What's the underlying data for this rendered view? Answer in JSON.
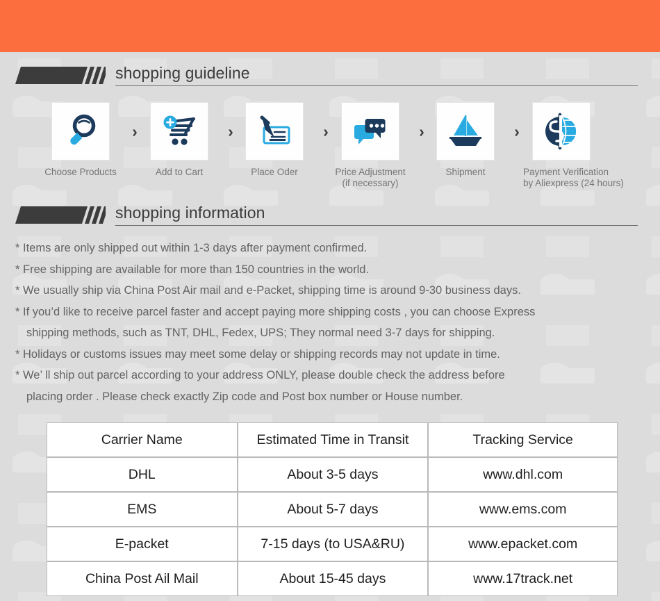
{
  "theme": {
    "accent_orange": "#fc6e3d",
    "page_background": "#dcdcdc",
    "banner_dark": "#3c3c3c",
    "icon_navy": "#1b3a5c",
    "icon_cyan": "#29abe2",
    "text_gray": "#636363",
    "table_border": "#b9b9b9"
  },
  "sections": {
    "guideline": {
      "title": "shopping guideline"
    },
    "information": {
      "title": "shopping information"
    }
  },
  "steps": [
    {
      "icon": "magnifier-icon",
      "label_line1": "Choose Products",
      "label_line2": ""
    },
    {
      "icon": "add-to-cart-icon",
      "label_line1": "Add to Cart",
      "label_line2": ""
    },
    {
      "icon": "pen-card-icon",
      "label_line1": "Place Oder",
      "label_line2": ""
    },
    {
      "icon": "chat-bubbles-icon",
      "label_line1": "Price Adjustment",
      "label_line2": "(if necessary)"
    },
    {
      "icon": "sailboat-icon",
      "label_line1": "Shipment",
      "label_line2": ""
    },
    {
      "icon": "dollar-globe-icon",
      "label_line1": "Payment Verification",
      "label_line2": "by  Aliexpress (24 hours)"
    }
  ],
  "step_separator": "›",
  "info_lines": [
    {
      "text": "* Items are only shipped out within 1-3 days after payment confirmed.",
      "indent": false
    },
    {
      "text": "* Free shipping are available for more than 150 countries in the world.",
      "indent": false
    },
    {
      "text": "* We usually ship via China Post Air mail and e-Packet, shipping time is around 9-30 business days.",
      "indent": false
    },
    {
      "text": "* If you’d like to receive parcel faster and accept paying more shipping costs , you can choose Express",
      "indent": false
    },
    {
      "text": "shipping methods, such as TNT, DHL, Fedex, UPS; They normal need 3-7 days for shipping.",
      "indent": true
    },
    {
      "text": "* Holidays or customs issues may meet some delay or shipping records may not update in time.",
      "indent": false
    },
    {
      "text": "* We’ ll ship out parcel according to your address ONLY, please double check the address before",
      "indent": false
    },
    {
      "text": "placing order . Please check exactly Zip code and Post box number or House number.",
      "indent": true
    }
  ],
  "carrier_table": {
    "headers": [
      "Carrier Name",
      "Estimated Time in Transit",
      "Tracking Service"
    ],
    "rows": [
      [
        "DHL",
        "About 3-5 days",
        "www.dhl.com"
      ],
      [
        "EMS",
        "About 5-7 days",
        "www.ems.com"
      ],
      [
        "E-packet",
        "7-15 days (to USA&RU)",
        "www.epacket.com"
      ],
      [
        "China Post Ail Mail",
        "About 15-45 days",
        "www.17track.net"
      ]
    ]
  }
}
